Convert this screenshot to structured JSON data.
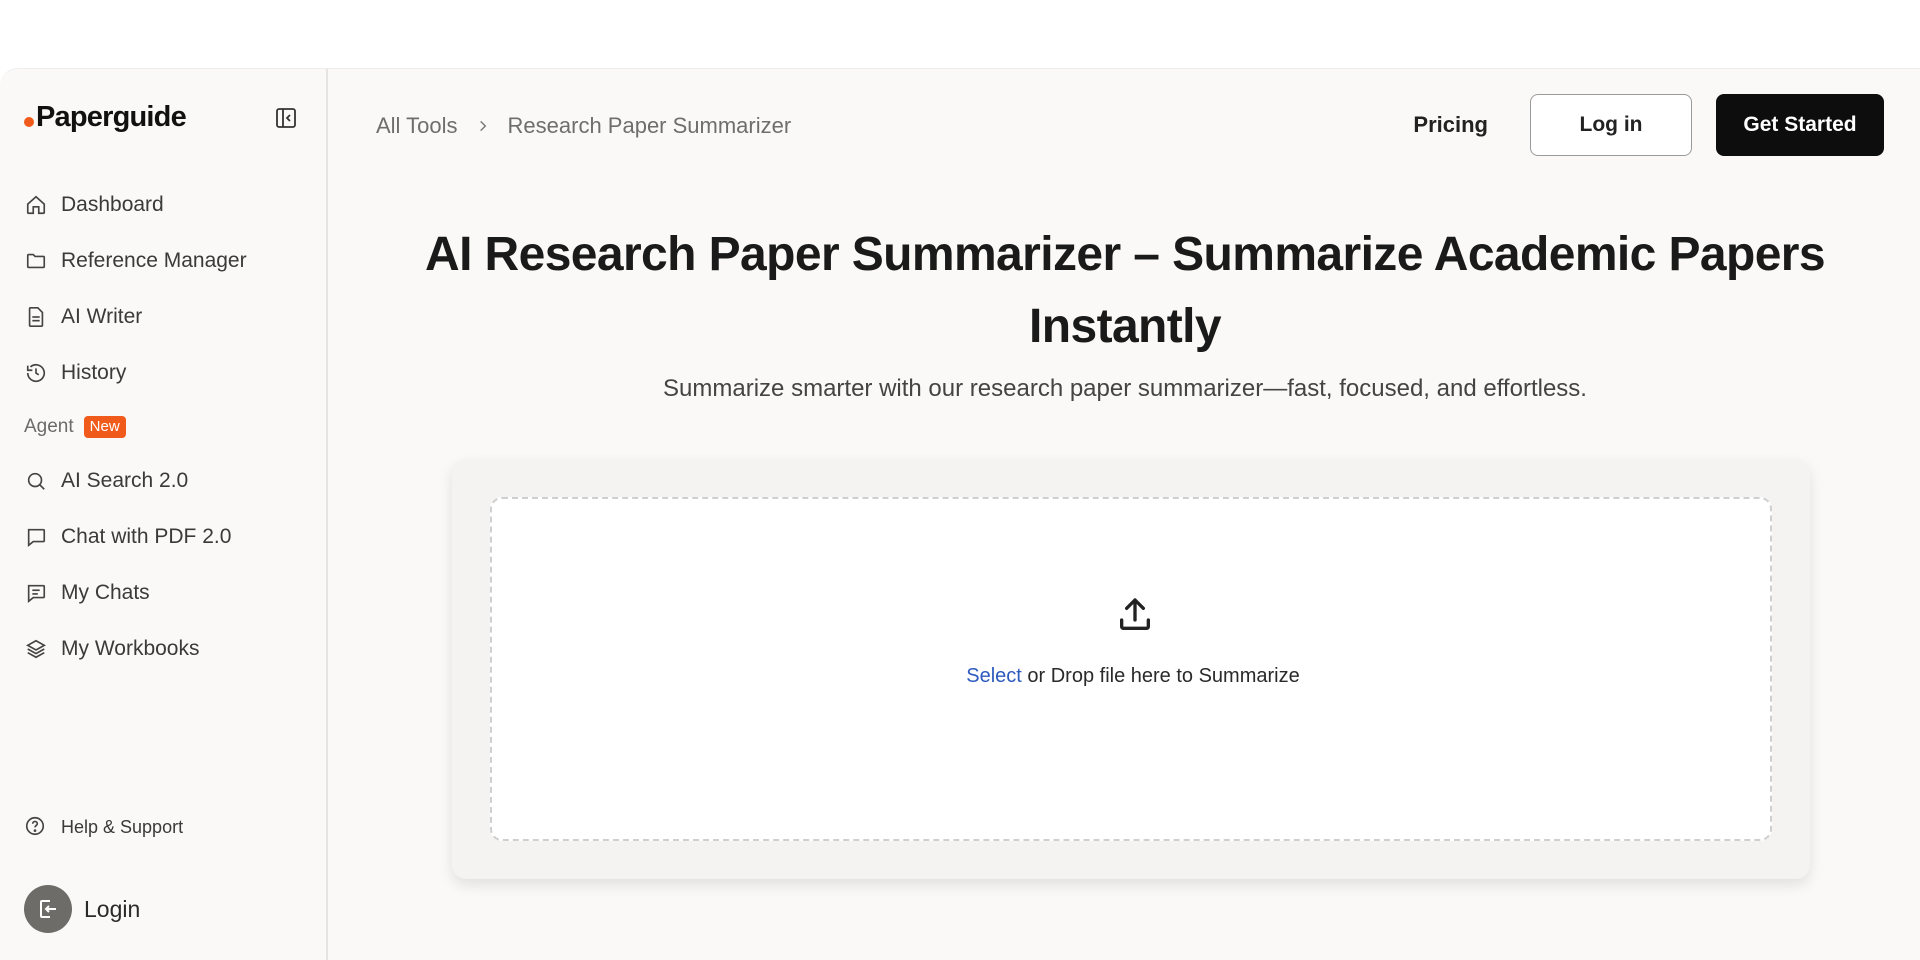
{
  "brand": {
    "name": "Paperguide",
    "accent": "#f05a1a"
  },
  "sidebar": {
    "items": [
      {
        "label": "Dashboard",
        "icon": "home-icon"
      },
      {
        "label": "Reference Manager",
        "icon": "folder-icon"
      },
      {
        "label": "AI Writer",
        "icon": "document-icon"
      },
      {
        "label": "History",
        "icon": "history-icon"
      }
    ],
    "section": {
      "label": "Agent",
      "badge": "New"
    },
    "agent_items": [
      {
        "label": "AI Search 2.0",
        "icon": "search-icon"
      },
      {
        "label": "Chat with PDF 2.0",
        "icon": "chat-icon"
      },
      {
        "label": "My Chats",
        "icon": "chat-lines-icon"
      },
      {
        "label": "My Workbooks",
        "icon": "layers-icon"
      }
    ],
    "help_label": "Help & Support",
    "login_label": "Login"
  },
  "breadcrumb": {
    "root": "All Tools",
    "current": "Research Paper Summarizer"
  },
  "topnav": {
    "pricing": "Pricing",
    "login": "Log in",
    "get_started": "Get Started"
  },
  "hero": {
    "title_line1": "AI Research Paper Summarizer – Summarize Academic Papers",
    "title_line2": "Instantly",
    "subtitle": "Summarize smarter with our research paper summarizer—fast, focused, and effortless."
  },
  "upload": {
    "select_label": "Select",
    "drop_text": " or Drop file here to Summarize"
  }
}
